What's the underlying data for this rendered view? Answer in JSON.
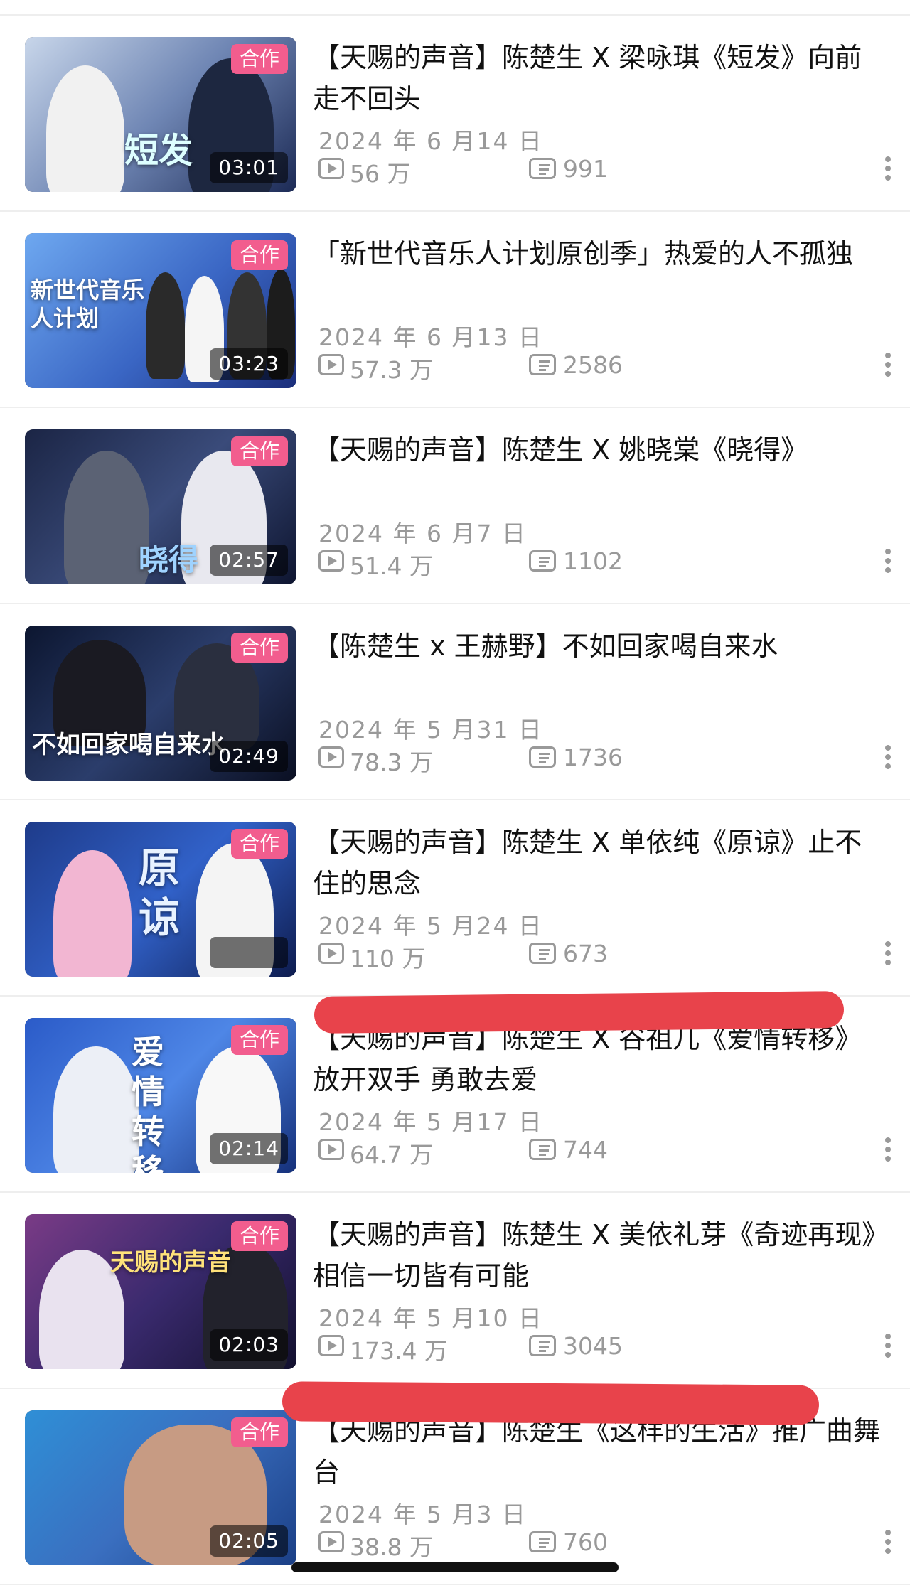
{
  "colors": {
    "badge": "#f25d8e",
    "meta_text": "#999999",
    "redaction": "#e8434b"
  },
  "videos": [
    {
      "badge": "合作",
      "duration": "03:01",
      "title": "【天赐的声音】陈楚生 X 梁咏琪《短发》向前走不回头",
      "date": "2024 年 6 月14 日",
      "views": "56 万",
      "comments": "991",
      "thumb_text": "短发"
    },
    {
      "badge": "合作",
      "duration": "03:23",
      "title": "「新世代音乐人计划原创季」热爱的人不孤独",
      "date": "2024 年 6 月13 日",
      "views": "57.3 万",
      "comments": "2586",
      "thumb_text": "新世代音乐人计划"
    },
    {
      "badge": "合作",
      "duration": "02:57",
      "title": "【天赐的声音】陈楚生 X 姚晓棠《晓得》",
      "date": "2024 年 6 月7 日",
      "views": "51.4 万",
      "comments": "1102",
      "thumb_text": "晓得"
    },
    {
      "badge": "合作",
      "duration": "02:49",
      "title": "【陈楚生 x 王赫野】不如回家喝自来水",
      "date": "2024 年 5 月31 日",
      "views": "78.3 万",
      "comments": "1736",
      "thumb_text": "不如回家喝自来水"
    },
    {
      "badge": "合作",
      "duration": "",
      "title": "【天赐的声音】陈楚生 X 单依纯《原谅》止不住的思念",
      "date": "2024 年 5 月24 日",
      "views": "110 万",
      "comments": "673",
      "thumb_text": "原谅"
    },
    {
      "badge": "合作",
      "duration": "02:14",
      "title": "【天赐的声音】陈楚生 X 谷祖儿《爱情转移》放开双手 勇敢去爱",
      "date": "2024 年 5 月17 日",
      "views": "64.7 万",
      "comments": "744",
      "thumb_text": "爱情转移"
    },
    {
      "badge": "合作",
      "duration": "02:03",
      "title": "【天赐的声音】陈楚生 X 美依礼芽《奇迹再现》相信一切皆有可能",
      "date": "2024 年 5 月10 日",
      "views": "173.4 万",
      "comments": "3045",
      "thumb_text": "天赐的声音"
    },
    {
      "badge": "合作",
      "duration": "02:05",
      "title": "【天赐的声音】陈楚生《这样的生活》推广曲舞台",
      "date": "2024 年 5 月3 日",
      "views": "38.8 万",
      "comments": "760",
      "thumb_text": ""
    }
  ]
}
